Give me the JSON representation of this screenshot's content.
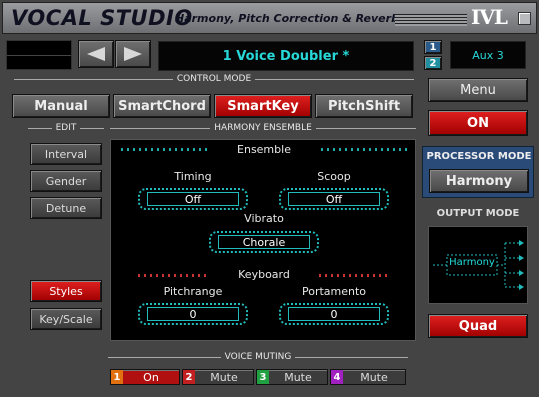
{
  "title": {
    "app": "VOCAL STUDIO",
    "subtitle": "Harmony, Pitch Correction & Reverb",
    "logo": "IVL"
  },
  "top": {
    "preset_name": "1 Voice Doubler *",
    "channel_1": "1",
    "channel_2": "2",
    "aux": "Aux 3"
  },
  "control_mode": {
    "label": "CONTROL MODE",
    "modes": [
      "Manual",
      "SmartChord",
      "SmartKey",
      "PitchShift"
    ],
    "selected": "SmartKey"
  },
  "edit": {
    "label": "EDIT",
    "buttons": [
      "Interval",
      "Gender",
      "Detune"
    ],
    "styles": "Styles",
    "key_scale": "Key/Scale"
  },
  "harmony_ensemble": {
    "label": "HARMONY ENSEMBLE",
    "ensemble": "Ensemble",
    "timing_label": "Timing",
    "timing_value": "Off",
    "scoop_label": "Scoop",
    "scoop_value": "Off",
    "vibrato_label": "Vibrato",
    "vibrato_value": "Chorale",
    "keyboard": "Keyboard",
    "pitchrange_label": "Pitchrange",
    "pitchrange_value": "0",
    "portamento_label": "Portamento",
    "portamento_value": "0"
  },
  "right": {
    "menu": "Menu",
    "on": "ON",
    "processor_mode_label": "PROCESSOR MODE",
    "processor_mode_value": "Harmony",
    "output_mode_label": "OUTPUT MODE",
    "output_diagram_label": "Harmony",
    "quad": "Quad"
  },
  "voice_muting": {
    "label": "VOICE MUTING",
    "voices": [
      {
        "num": "1",
        "state": "On",
        "color": "#e07010"
      },
      {
        "num": "2",
        "state": "Mute",
        "color": "#c02020"
      },
      {
        "num": "3",
        "state": "Mute",
        "color": "#20a040"
      },
      {
        "num": "4",
        "state": "Mute",
        "color": "#a020c0"
      }
    ]
  },
  "colors": {
    "accent_red": "#d01010",
    "lcd_cyan": "#28d8d8",
    "panel_blue": "#2a4a78"
  }
}
